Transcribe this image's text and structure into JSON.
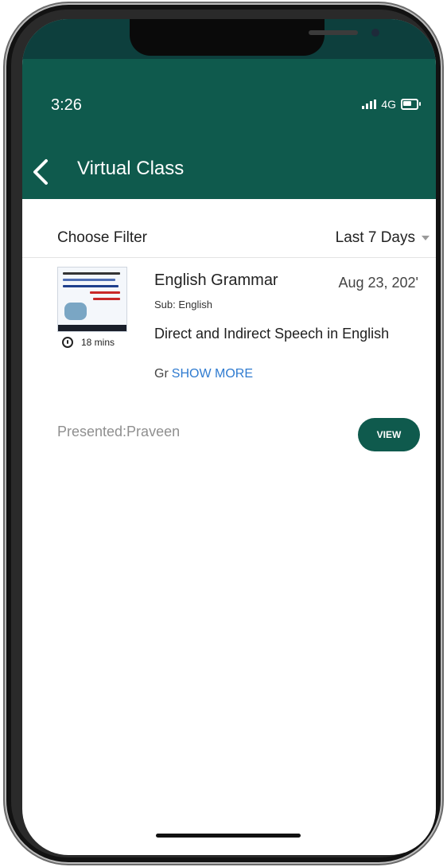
{
  "status_bar": {
    "time": "3:26",
    "network": "4G"
  },
  "header": {
    "title": "Virtual Class"
  },
  "filter": {
    "label": "Choose Filter",
    "selected": "Last 7 Days"
  },
  "class_card": {
    "duration": "18 mins",
    "title": "English Grammar",
    "date": "Aug 23, 202'",
    "subject": "Sub: English",
    "topic": "Direct and Indirect Speech in English",
    "description_preview": "Gr",
    "show_more_label": "SHOW MORE",
    "presenter": "Presented:Praveen",
    "view_label": "VIEW"
  },
  "colors": {
    "brand": "#0f5a4d",
    "link": "#2f7bd0"
  }
}
